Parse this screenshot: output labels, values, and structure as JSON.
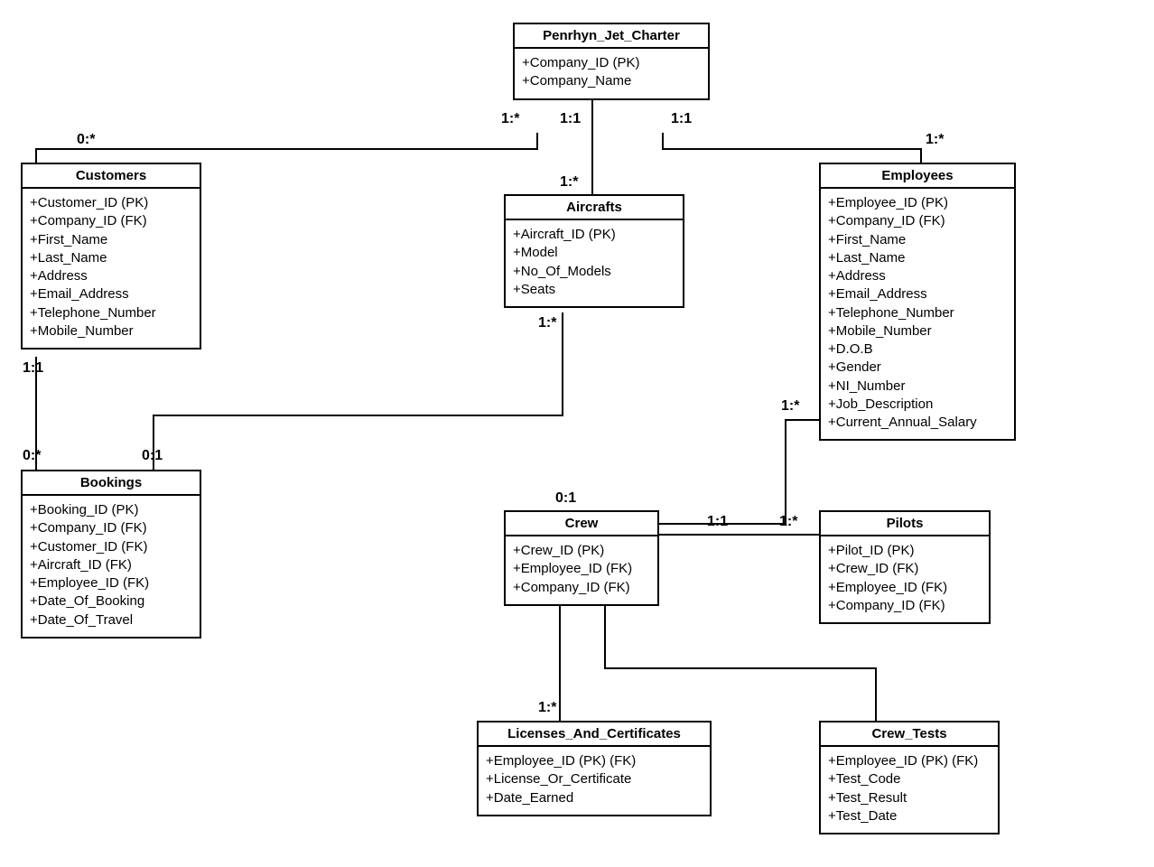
{
  "entities": {
    "penrhyn": {
      "title": "Penrhyn_Jet_Charter",
      "attrs": [
        "+Company_ID (PK)",
        "+Company_Name"
      ]
    },
    "customers": {
      "title": "Customers",
      "attrs": [
        "+Customer_ID (PK)",
        "+Company_ID (FK)",
        "+First_Name",
        "+Last_Name",
        "+Address",
        "+Email_Address",
        "+Telephone_Number",
        "+Mobile_Number"
      ]
    },
    "aircrafts": {
      "title": "Aircrafts",
      "attrs": [
        "+Aircraft_ID (PK)",
        "+Model",
        "+No_Of_Models",
        "+Seats"
      ]
    },
    "employees": {
      "title": "Employees",
      "attrs": [
        "+Employee_ID (PK)",
        "+Company_ID (FK)",
        "+First_Name",
        "+Last_Name",
        "+Address",
        "+Email_Address",
        "+Telephone_Number",
        "+Mobile_Number",
        "+D.O.B",
        "+Gender",
        "+NI_Number",
        "+Job_Description",
        "+Current_Annual_Salary"
      ]
    },
    "bookings": {
      "title": "Bookings",
      "attrs": [
        "+Booking_ID (PK)",
        "+Company_ID (FK)",
        "+Customer_ID (FK)",
        "+Aircraft_ID (FK)",
        "+Employee_ID (FK)",
        "+Date_Of_Booking",
        "+Date_Of_Travel"
      ]
    },
    "crew": {
      "title": "Crew",
      "attrs": [
        "+Crew_ID (PK)",
        "+Employee_ID (FK)",
        "+Company_ID (FK)"
      ]
    },
    "pilots": {
      "title": "Pilots",
      "attrs": [
        "+Pilot_ID (PK)",
        "+Crew_ID (FK)",
        "+Employee_ID (FK)",
        "+Company_ID (FK)"
      ]
    },
    "licenses": {
      "title": "Licenses_And_Certificates",
      "attrs": [
        "+Employee_ID (PK) (FK)",
        "+License_Or_Certificate",
        "+Date_Earned"
      ]
    },
    "crewtests": {
      "title": "Crew_Tests",
      "attrs": [
        "+Employee_ID (PK) (FK)",
        "+Test_Code",
        "+Test_Result",
        "+Test_Date"
      ]
    }
  },
  "cards": {
    "pen_cust_pen": "1:*",
    "pen_cust_cust": "0:*",
    "pen_air_top": "1:1",
    "pen_air_bot": "1:*",
    "pen_emp_pen": "1:1",
    "pen_emp_emp": "1:*",
    "cust_book_cust": "1:1",
    "cust_book_book": "0:*",
    "air_book_air": "1:*",
    "air_book_book": "0:1",
    "emp_crew_emp": "1:*",
    "emp_crew_crew": "0:1",
    "crew_pilots_crew": "1:1",
    "crew_pilots_pilots": "1:*",
    "crew_lic": "1:*"
  }
}
